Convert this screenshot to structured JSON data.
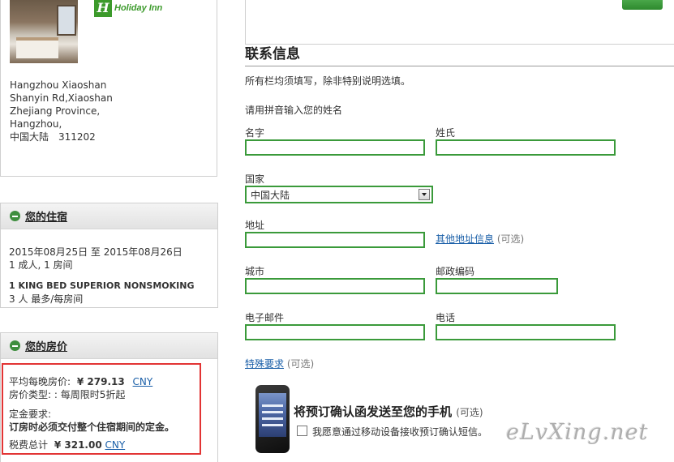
{
  "hotel": {
    "brand": "Holiday Inn",
    "address_lines": [
      "Hangzhou Xiaoshan",
      "Shanyin Rd,Xiaoshan",
      "Zhejiang Province,",
      "Hangzhou,",
      "中国大陆　311202"
    ]
  },
  "stay": {
    "title": "您的住宿",
    "dates": "2015年08月25日 至 2015年08月26日",
    "guests": "1 成人, 1 房间",
    "room": "1 KING BED SUPERIOR NONSMOKING",
    "occupancy": "3 人 最多/每房间"
  },
  "price": {
    "title": "您的房价",
    "avg_label": "平均每晚房价:",
    "avg_value": "¥ 279.13",
    "currency": "CNY",
    "rate_type": "房价类型: : 每周限时5折起",
    "deposit_label": "定金要求:",
    "deposit_text": "订房时必须交付整个住宿期间的定金。",
    "total_label": "税费总计",
    "total_value": "¥ 321.00",
    "total_currency": "CNY"
  },
  "contact": {
    "title": "联系信息",
    "note": "所有栏均须填写，除非特别说明选填。",
    "pinyin_note": "请用拼音输入您的姓名",
    "first_name_label": "名字",
    "last_name_label": "姓氏",
    "country_label": "国家",
    "country_value": "中国大陆",
    "address_label": "地址",
    "other_address_link": "其他地址信息",
    "optional": "(可选)",
    "city_label": "城市",
    "postcode_label": "邮政编码",
    "email_label": "电子邮件",
    "phone_label": "电话",
    "special_request_link": "特殊要求"
  },
  "sms": {
    "title": "将预订确认函发送至您的手机",
    "optional": "(可选)",
    "checkbox_label": "我愿意通过移动设备接收预订确认短信。"
  },
  "watermark": "eLvXing.net"
}
